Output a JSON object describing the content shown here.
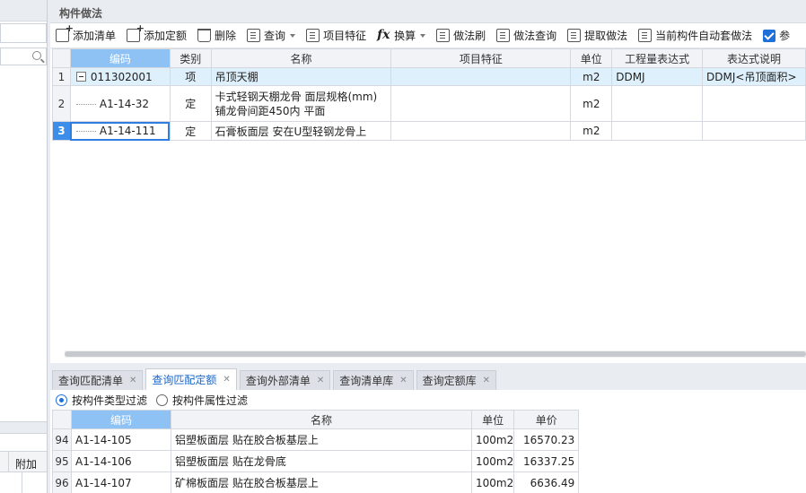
{
  "upper_panel": {
    "title": "构件做法",
    "toolbar": [
      {
        "name": "add-list-button",
        "label": "添加清单",
        "icon": "add-list-icon",
        "cls": "plus"
      },
      {
        "name": "add-quota-button",
        "label": "添加定额",
        "icon": "add-quota-icon",
        "cls": "plus"
      },
      {
        "name": "delete-button",
        "label": "删除",
        "icon": "trash-icon",
        "cls": "trash"
      },
      {
        "name": "query-button",
        "label": "查询",
        "icon": "query-icon",
        "cls": "doc",
        "caret": true
      },
      {
        "name": "item-feature-button",
        "label": "项目特征",
        "icon": "feature-icon",
        "cls": "doc"
      },
      {
        "name": "convert-button",
        "label": "换算",
        "icon": "fx-icon",
        "cls": "fx",
        "caret": true
      },
      {
        "name": "method-brush-button",
        "label": "做法刷",
        "icon": "brush-icon",
        "cls": "doc"
      },
      {
        "name": "method-query-button",
        "label": "做法查询",
        "icon": "search-doc-icon",
        "cls": "doc"
      },
      {
        "name": "extract-method-button",
        "label": "提取做法",
        "icon": "extract-icon",
        "cls": "doc"
      },
      {
        "name": "auto-apply-button",
        "label": "当前构件自动套做法",
        "icon": "auto-apply-icon",
        "cls": "doc"
      }
    ],
    "checkbox_label": "参",
    "columns": [
      "编码",
      "类别",
      "名称",
      "项目特征",
      "单位",
      "工程量表达式",
      "表达式说明"
    ],
    "rows": [
      {
        "no": "1",
        "code": "011302001",
        "type": "项",
        "name": "吊顶天棚",
        "feature": "",
        "unit": "m2",
        "expr": "DDMJ",
        "desc": "DDMJ<吊顶面积>"
      },
      {
        "no": "2",
        "code": "A1-14-32",
        "type": "定",
        "name": "卡式轻钢天棚龙骨 面层规格(mm) 铺龙骨间距450内 平面",
        "feature": "",
        "unit": "m2",
        "expr": "",
        "desc": ""
      },
      {
        "no": "3",
        "code": "A1-14-111",
        "type": "定",
        "name": "石膏板面层 安在U型轻钢龙骨上",
        "feature": "",
        "unit": "m2",
        "expr": "",
        "desc": ""
      }
    ]
  },
  "lower_panel": {
    "tabs": [
      {
        "label": "查询匹配清单",
        "active": false
      },
      {
        "label": "查询匹配定额",
        "active": true
      },
      {
        "label": "查询外部清单",
        "active": false
      },
      {
        "label": "查询清单库",
        "active": false
      },
      {
        "label": "查询定额库",
        "active": false
      }
    ],
    "filters": [
      {
        "label": "按构件类型过滤",
        "checked": true
      },
      {
        "label": "按构件属性过滤",
        "checked": false
      }
    ],
    "columns": [
      "编码",
      "名称",
      "单位",
      "单价"
    ],
    "rows": [
      {
        "no": "94",
        "code": "A1-14-105",
        "name": "铝塑板面层 贴在胶合板基层上",
        "unit": "100m2",
        "price": "16570.23"
      },
      {
        "no": "95",
        "code": "A1-14-106",
        "name": "铝塑板面层 贴在龙骨底",
        "unit": "100m2",
        "price": "16337.25"
      },
      {
        "no": "96",
        "code": "A1-14-107",
        "name": "矿棉板面层 贴在胶合板基层上",
        "unit": "100m2",
        "price": "6636.49"
      }
    ]
  },
  "left_panel": {
    "column_label": "附加"
  }
}
